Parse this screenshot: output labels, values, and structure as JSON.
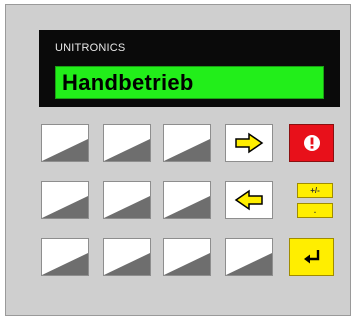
{
  "device": {
    "brand": "UNITRONICS",
    "display_text": "Handbetrieb"
  },
  "keys": {
    "plus_minus_label": "+/-",
    "decimal_label": "."
  },
  "colors": {
    "panel": "#cfcfcf",
    "lcd_background": "#22ee1a",
    "alarm_key": "#e8101a",
    "function_key": "#ffee00"
  },
  "icons": {
    "right_arrow": "arrow-right-icon",
    "left_arrow": "arrow-left-icon",
    "alarm": "exclamation-icon",
    "enter": "enter-icon"
  }
}
